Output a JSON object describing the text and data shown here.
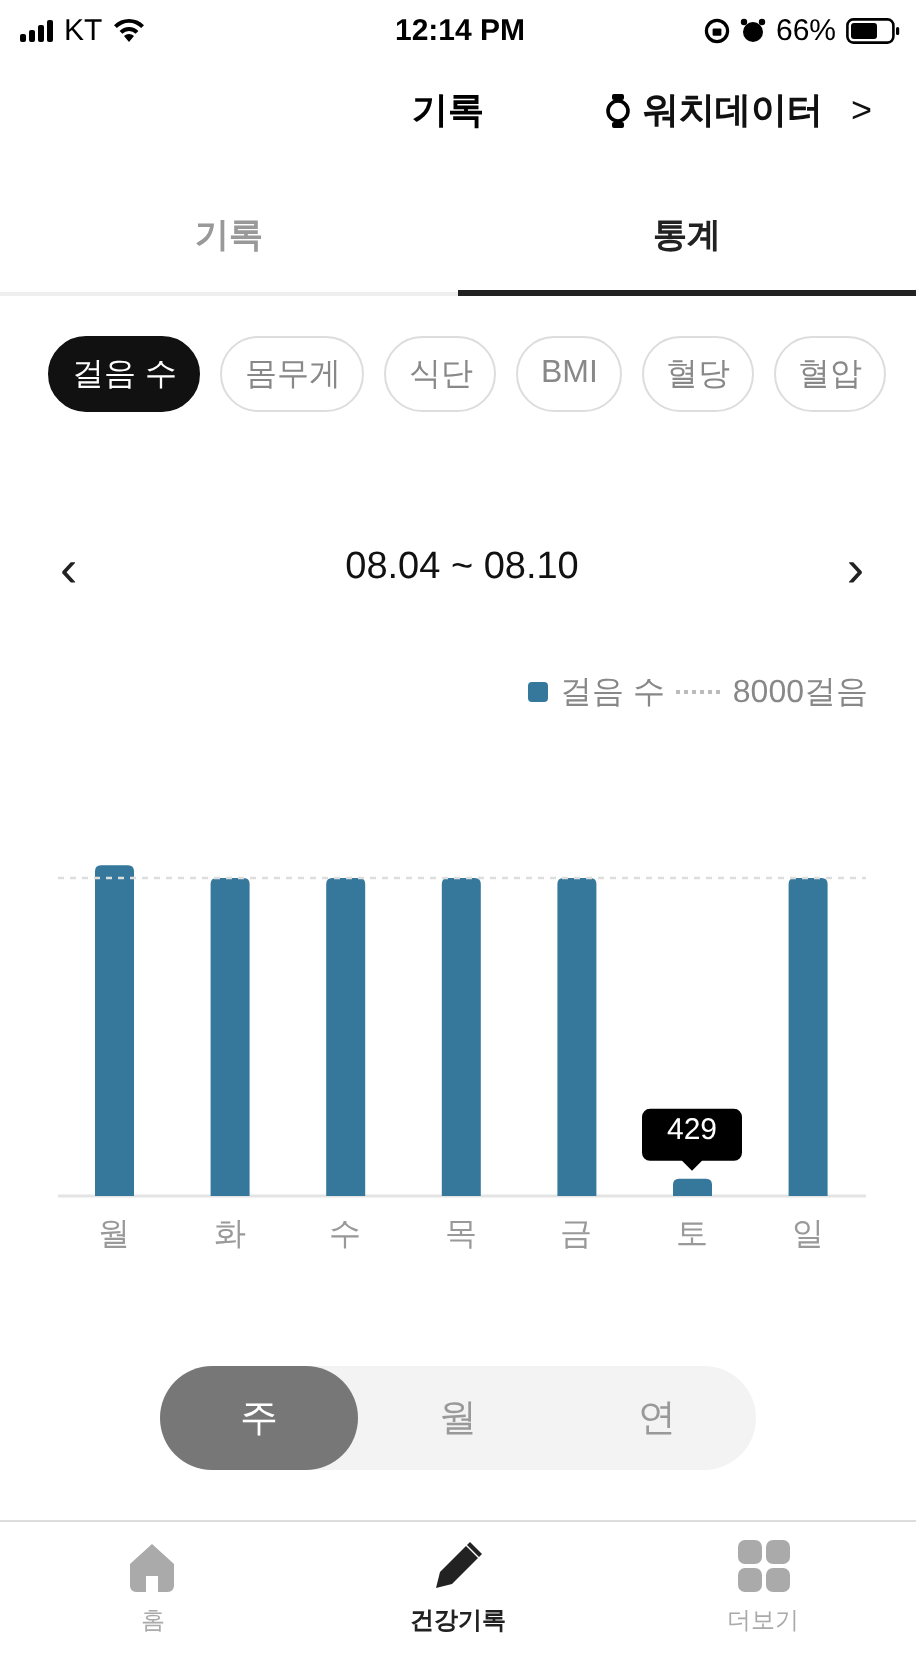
{
  "status_bar": {
    "carrier": "KT",
    "time": "12:14 PM",
    "battery": "66%"
  },
  "header": {
    "title": "기록",
    "watch_link": "워치데이터",
    "chevron": ">"
  },
  "tabs": [
    {
      "label": "기록",
      "selected": false
    },
    {
      "label": "통계",
      "selected": true
    }
  ],
  "chips": [
    {
      "label": "걸음 수",
      "selected": true
    },
    {
      "label": "몸무게",
      "selected": false
    },
    {
      "label": "식단",
      "selected": false
    },
    {
      "label": "BMI",
      "selected": false
    },
    {
      "label": "혈당",
      "selected": false
    },
    {
      "label": "혈압",
      "selected": false
    }
  ],
  "date_nav": {
    "prev": "‹",
    "range": "08.04 ~ 08.10",
    "next": "›"
  },
  "chart": {
    "legend": [
      {
        "kind": "swatch",
        "label": "걸음 수"
      },
      {
        "kind": "dotted",
        "label": "8000걸음"
      }
    ],
    "days": [
      "월",
      "화",
      "수",
      "목",
      "금",
      "토",
      "일"
    ],
    "tooltip": "429"
  },
  "period": [
    {
      "label": "주",
      "selected": true
    },
    {
      "label": "월",
      "selected": false
    },
    {
      "label": "연",
      "selected": false
    }
  ],
  "bottom_nav": [
    {
      "label": "홈",
      "selected": false
    },
    {
      "label": "건강기록",
      "selected": true
    },
    {
      "label": "더보기",
      "selected": false
    }
  ]
}
